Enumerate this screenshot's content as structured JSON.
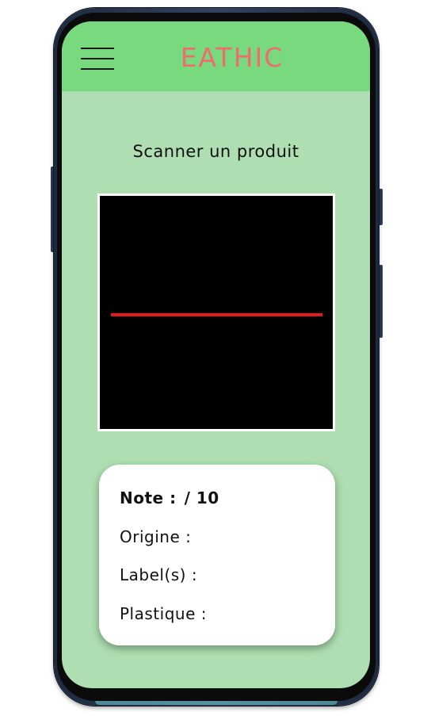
{
  "app": {
    "title": "EATHIC"
  },
  "header": {
    "menu_icon": "hamburger-menu-icon"
  },
  "main": {
    "scan_title": "Scanner un produit",
    "scanner": {
      "line_color": "#e31b1b",
      "background": "#000000"
    }
  },
  "info_card": {
    "note_label": "Note :",
    "note_value": "/ 10",
    "origine_label": "Origine :",
    "labels_label": "Label(s) :",
    "plastique_label": "Plastique :"
  },
  "colors": {
    "header_bg": "#79d97e",
    "screen_bg": "#aedeb1",
    "title_color": "#ef6c6c"
  }
}
